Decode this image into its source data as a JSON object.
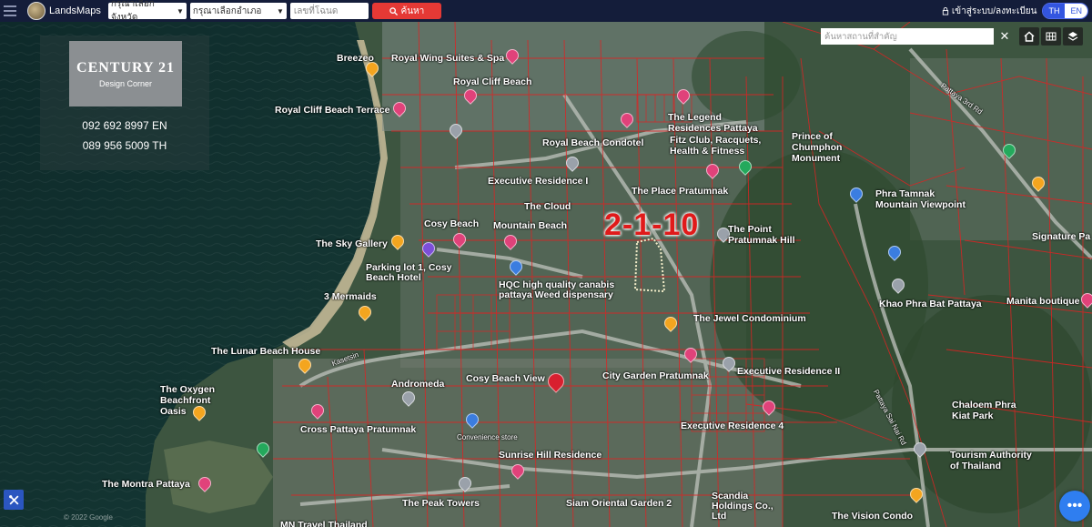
{
  "topbar": {
    "brand": "LandsMaps",
    "province_placeholder": "กรุณาเลือกจังหวัด",
    "district_placeholder": "กรุณาเลือกอำเภอ",
    "deed_placeholder": "เลขที่โฉนด",
    "search_label": "ค้นหา",
    "login_label": "เข้าสู่ระบบ/ลงทะเบียน",
    "lang_th": "TH",
    "lang_en": "EN"
  },
  "map_search": {
    "placeholder": "ค้นหาสถานที่สำคัญ"
  },
  "agent_card": {
    "title": "CENTURY 21",
    "subtitle": "Design Corner",
    "phone_en": "092 692 8997 EN",
    "phone_th": "089 956 5009 TH"
  },
  "parcel": {
    "label": "2-1-10"
  },
  "places": [
    {
      "name": "Royal Wing Suites & Spa"
    },
    {
      "name": "Royal Cliff Beach"
    },
    {
      "name": "Royal Cliff Beach Terrace"
    },
    {
      "name": "Royal Beach Condotel"
    },
    {
      "name": "The Legend Residences Pattaya"
    },
    {
      "name": "Fitz Club, Racquets, Health & Fitness"
    },
    {
      "name": "Prince of Chumphon Monument"
    },
    {
      "name": "Executive Residence I"
    },
    {
      "name": "The Place Pratumnak"
    },
    {
      "name": "Phra Tamnak Mountain Viewpoint"
    },
    {
      "name": "The Cloud"
    },
    {
      "name": "Cosy Beach"
    },
    {
      "name": "Mountain Beach"
    },
    {
      "name": "The Sky Gallery"
    },
    {
      "name": "The Point Pratumnak Hill"
    },
    {
      "name": "Parking lot 1, Cosy Beach Hotel"
    },
    {
      "name": "3 Mermaids"
    },
    {
      "name": "HQC high quality canabis pattaya Weed dispensary"
    },
    {
      "name": "Khao Phra Bat Pattaya"
    },
    {
      "name": "The Jewel Condominium"
    },
    {
      "name": "Manita boutique"
    },
    {
      "name": "The Lunar Beach House"
    },
    {
      "name": "Executive Residence II"
    },
    {
      "name": "The Oxygen Beachfront Oasis"
    },
    {
      "name": "Andromeda"
    },
    {
      "name": "Cosy Beach View"
    },
    {
      "name": "City Garden Pratumnak"
    },
    {
      "name": "Chaloem Phra Kiat Park"
    },
    {
      "name": "Cross Pattaya Pratumnak"
    },
    {
      "name": "Convenience store"
    },
    {
      "name": "Executive Residence 4"
    },
    {
      "name": "Sunrise Hill Residence"
    },
    {
      "name": "Tourism Authority of Thailand"
    },
    {
      "name": "The Montra Pattaya"
    },
    {
      "name": "The Peak Towers"
    },
    {
      "name": "Siam Oriental Garden 2"
    },
    {
      "name": "Scandia Holdings Co., Ltd"
    },
    {
      "name": "The Vision Condo"
    },
    {
      "name": "MN Travel Thailand"
    },
    {
      "name": "Breezeo"
    },
    {
      "name": "Signature Pa"
    }
  ],
  "roads": [
    {
      "name": "Kasetsin"
    },
    {
      "name": "Pattaya Sai Nai Rd"
    },
    {
      "name": "Pattaya 3rd Rd"
    }
  ],
  "copyright": "© 2022 Google",
  "icons": {
    "menu": "hamburger-icon",
    "search": "search-icon",
    "lock": "lock-icon",
    "home": "home-icon",
    "grid": "grid-icon",
    "layers": "layers-icon",
    "chat": "chat-dots-icon",
    "tools": "tools-icon"
  }
}
